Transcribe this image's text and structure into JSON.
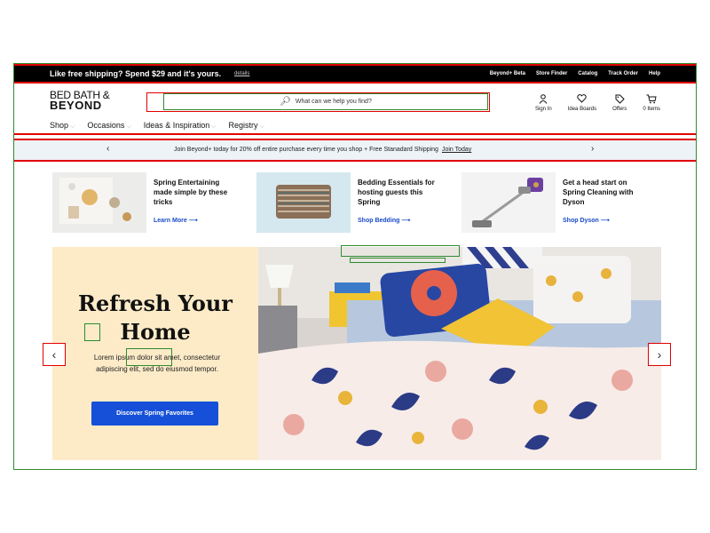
{
  "promo": {
    "text": "Like free shipping? Spend $29 and it's yours.",
    "details": "details",
    "links": [
      "Beyond+ Beta",
      "Store Finder",
      "Catalog",
      "Track Order",
      "Help"
    ]
  },
  "header": {
    "logo_line1": "BED BATH &",
    "logo_line2": "BEYOND",
    "search_placeholder": "What can we help you find?",
    "icons": [
      {
        "icon": "user-icon",
        "label": "Sign In"
      },
      {
        "icon": "heart-icon",
        "label": "Idea Boards"
      },
      {
        "icon": "tag-icon",
        "label": "Offers"
      },
      {
        "icon": "cart-icon",
        "label": "0 Items"
      }
    ],
    "nav": [
      "Shop",
      "Occasions",
      "Ideas & Inspiration",
      "Registry"
    ]
  },
  "join_banner": {
    "text": "Join Beyond+ today for 20% off entire purchase every time you shop + Free Stanadard Shipping",
    "link": "Join Today"
  },
  "cards": [
    {
      "title": "Spring Entertaining made simple by these tricks",
      "link": "Learn More"
    },
    {
      "title": "Bedding Essentials for hosting guests this Spring",
      "link": "Shop Bedding"
    },
    {
      "title": "Get a head start on Spring Cleaning with Dyson",
      "link": "Shop Dyson"
    }
  ],
  "hero": {
    "title_line1": "Refresh Your",
    "title_line2": "Home",
    "body": "Lorem ipsum dolor sit amet, consectetur adipiscing elit, sed do eiusmod tempor.",
    "button": "Discover Spring Favorites"
  },
  "colors": {
    "promo_bg": "#000000",
    "accent_blue": "#1650d8",
    "link_blue": "#1a4bc8",
    "hero_panel": "#fdebc8",
    "join_bg": "#eef3f8"
  }
}
